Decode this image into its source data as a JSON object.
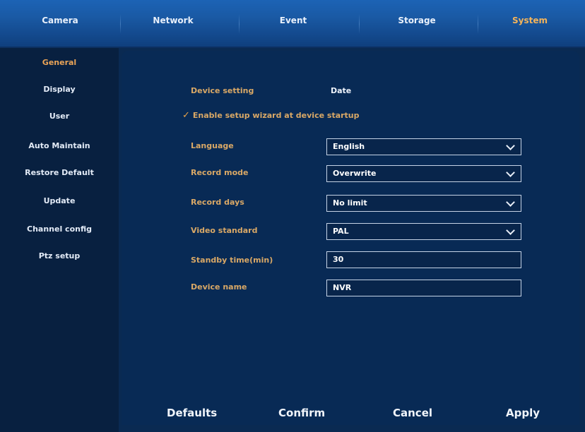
{
  "tabs": [
    {
      "label": "Camera",
      "active": false
    },
    {
      "label": "Network",
      "active": false
    },
    {
      "label": "Event",
      "active": false
    },
    {
      "label": "Storage",
      "active": false
    },
    {
      "label": "System",
      "active": true
    }
  ],
  "sidebar": {
    "items": [
      {
        "label": "General",
        "active": true
      },
      {
        "label": "Display",
        "active": false
      },
      {
        "label": "User",
        "active": false
      },
      {
        "label": "Auto Maintain",
        "active": false
      },
      {
        "label": "Restore Default",
        "active": false
      },
      {
        "label": "Update",
        "active": false
      },
      {
        "label": "Channel config",
        "active": false
      },
      {
        "label": "Ptz setup",
        "active": false
      }
    ]
  },
  "subtabs": {
    "device_setting": "Device setting",
    "date": "Date"
  },
  "wizard": {
    "label": "Enable setup wizard at device startup",
    "checked": true
  },
  "form": {
    "language": {
      "label": "Language",
      "value": "English"
    },
    "record_mode": {
      "label": "Record mode",
      "value": "Overwrite"
    },
    "record_days": {
      "label": "Record days",
      "value": "No limit"
    },
    "video_standard": {
      "label": "Video standard",
      "value": "PAL"
    },
    "standby_time": {
      "label": "Standby time(min)",
      "value": "30"
    },
    "device_name": {
      "label": "Device name",
      "value": "NVR"
    }
  },
  "buttons": {
    "defaults": "Defaults",
    "confirm": "Confirm",
    "cancel": "Cancel",
    "apply": "Apply"
  },
  "colors": {
    "accent": "#e9a357",
    "background": "#0a2a52",
    "topbar": "#1c63b5"
  }
}
